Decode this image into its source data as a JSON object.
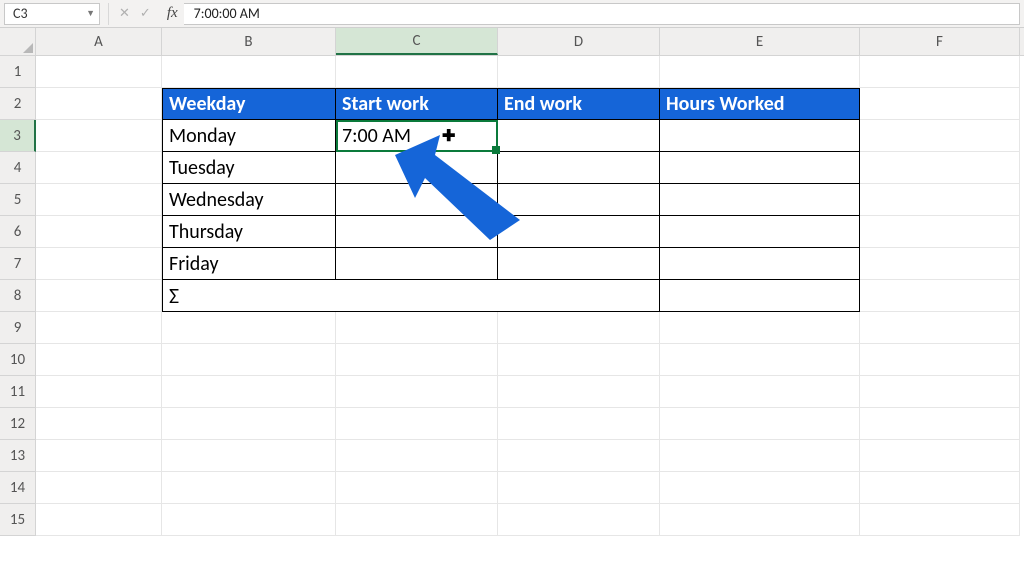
{
  "formula_bar": {
    "name_box": "C3",
    "formula_value": "7:00:00 AM",
    "fx_label": "fx",
    "cancel_icon": "✕",
    "enter_icon": "✓"
  },
  "columns": [
    "A",
    "B",
    "C",
    "D",
    "E",
    "F"
  ],
  "row_numbers": [
    "1",
    "2",
    "3",
    "4",
    "5",
    "6",
    "7",
    "8",
    "9",
    "10",
    "11",
    "12",
    "13",
    "14",
    "15"
  ],
  "active_col": "C",
  "active_row": "3",
  "headers": {
    "b": "Weekday",
    "c": "Start work",
    "d": "End work",
    "e": "Hours Worked"
  },
  "data_rows": {
    "r3": {
      "b": "Monday",
      "c": "7:00 AM",
      "d": "",
      "e": ""
    },
    "r4": {
      "b": "Tuesday",
      "c": "",
      "d": "",
      "e": ""
    },
    "r5": {
      "b": "Wednesday",
      "c": "",
      "d": "",
      "e": ""
    },
    "r6": {
      "b": "Thursday",
      "c": "",
      "d": "",
      "e": ""
    },
    "r7": {
      "b": "Friday",
      "c": "",
      "d": "",
      "e": ""
    },
    "r8": {
      "b": "Σ",
      "e": ""
    }
  },
  "colors": {
    "header_bg": "#1565d8",
    "arrow": "#1565d8",
    "selection": "#0a7a3b"
  }
}
